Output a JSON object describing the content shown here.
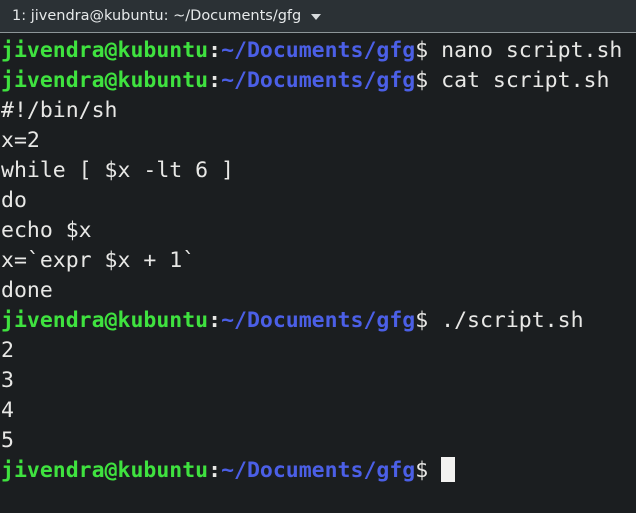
{
  "window": {
    "background_color": "#1b1e20",
    "tabbar_background_color": "#2b3135"
  },
  "tabbar": {
    "tab_label": "1: jivendra@kubuntu: ~/Documents/gfg",
    "dropdown_icon": "chevron-down-icon"
  },
  "terminal": {
    "colors": {
      "user_host": "#3fe23f",
      "path": "#4b5fe6",
      "text": "#e8e8e6",
      "background": "#1b1e20",
      "cursor": "#f2f2f0"
    },
    "prompt": {
      "user_host": "jivendra@kubuntu",
      "separator": ":",
      "path": "~/Documents/gfg",
      "sigil": "$"
    },
    "lines": [
      {
        "type": "prompt",
        "command": " nano script.sh"
      },
      {
        "type": "prompt",
        "command": " cat script.sh"
      },
      {
        "type": "output",
        "text": "#!/bin/sh"
      },
      {
        "type": "output",
        "text": "x=2"
      },
      {
        "type": "output",
        "text": "while [ $x -lt 6 ]"
      },
      {
        "type": "output",
        "text": "do"
      },
      {
        "type": "output",
        "text": "echo $x"
      },
      {
        "type": "output",
        "text": "x=`expr $x + 1`"
      },
      {
        "type": "output",
        "text": "done"
      },
      {
        "type": "prompt",
        "command": " ./script.sh"
      },
      {
        "type": "output",
        "text": "2"
      },
      {
        "type": "output",
        "text": "3"
      },
      {
        "type": "output",
        "text": "4"
      },
      {
        "type": "output",
        "text": "5"
      },
      {
        "type": "prompt",
        "command": " ",
        "cursor": true
      }
    ]
  }
}
